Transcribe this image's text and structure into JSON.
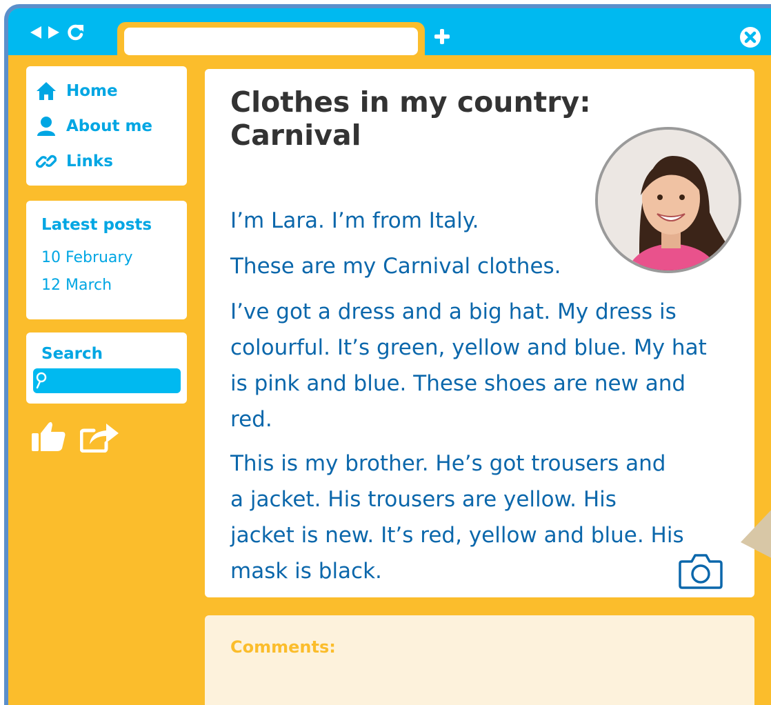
{
  "browser": {
    "address_value": "",
    "back_icon": "triangle-left",
    "forward_icon": "triangle-right",
    "reload_icon": "reload",
    "new_tab_icon": "plus",
    "close_icon": "x-circle"
  },
  "sidebar": {
    "nav": [
      {
        "label": "Home",
        "icon": "home-icon"
      },
      {
        "label": "About me",
        "icon": "person-icon"
      },
      {
        "label": "Links",
        "icon": "link-icon"
      }
    ],
    "latest_posts": {
      "title": "Latest posts",
      "items": [
        "10 February",
        "12 March"
      ]
    },
    "search": {
      "title": "Search",
      "value": ""
    }
  },
  "post": {
    "title": "Clothes in my country: Carnival",
    "paragraphs": [
      "I’m Lara. I’m from Italy.",
      "These are my Carnival clothes.",
      "I’ve got a dress and a big hat. My dress is colourful. It’s green, yellow and blue. My hat is pink and blue. These shoes are new and red.",
      "This is my brother. He’s got trousers and a jacket. His trousers are yellow. His jacket is new. It’s red, yellow and blue. His mask is black."
    ]
  },
  "comments": {
    "label": "Comments:"
  },
  "colors": {
    "frame": "#fbbd2c",
    "titlebar": "#00b9f0",
    "link": "#00a6e3",
    "body_text": "#0b67ab",
    "heading": "#333333",
    "border": "#5b8fcb",
    "comments_bg": "#fdf2dc"
  }
}
